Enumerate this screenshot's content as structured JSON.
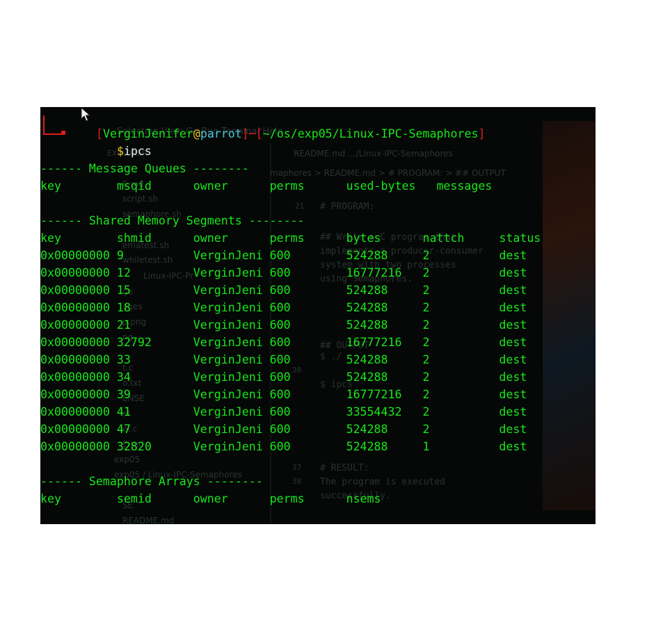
{
  "prompt": {
    "open_bracket": "[",
    "user": "VerginJenifer",
    "at": "@",
    "host": "parrot",
    "separator": "]─[",
    "path": "~/os/exp05/Linux-IPC-Semaphores",
    "close_bracket": "]",
    "symbol": "$",
    "command": "ipcs"
  },
  "message_queues": {
    "header": "------ Message Queues --------",
    "columns": "key        msqid      owner      perms      used-bytes   messages"
  },
  "shared_memory": {
    "header": "------ Shared Memory Segments --------",
    "columns": "key        shmid      owner      perms      bytes      nattch     status",
    "rows": [
      "0x00000000 9          VerginJeni 600        524288     2          dest",
      "0x00000000 12         VerginJeni 600        16777216   2          dest",
      "0x00000000 15         VerginJeni 600        524288     2          dest",
      "0x00000000 18         VerginJeni 600        524288     2          dest",
      "0x00000000 21         VerginJeni 600        524288     2          dest",
      "0x00000000 32792      VerginJeni 600        16777216   2          dest",
      "0x00000000 33         VerginJeni 600        524288     2          dest",
      "0x00000000 34         VerginJeni 600        524288     2          dest",
      "0x00000000 39         VerginJeni 600        16777216   2          dest",
      "0x00000000 41         VerginJeni 600        33554432   2          dest",
      "0x00000000 47         VerginJeni 600        524288     2          dest",
      "0x00000000 32820      VerginJeni 600        524288     1          dest"
    ]
  },
  "semaphore_arrays": {
    "header": "------ Semaphore Arrays --------",
    "columns": "key        semid      owner      perms      nsems"
  },
  "background": {
    "menu": "Selection  View  Go  Run  Terminal  Help",
    "explorer_title": "EXPLORER",
    "tab_title": "README.md  .../Linux-IPC-Semaphores",
    "breadcrumb": "maphores > README.md > # PROGRAM: > ## OUTPUT",
    "files": [
      "E.md",
      "script.sh",
      "semaphore.sh",
      "ematest.sh",
      "whiletest.sh",
      "Linux-IPC-Pr",
      "ge",
      "ages",
      "p.png",
      "ng",
      "t.c",
      "o.txt",
      "ENSE",
      "el",
      "el.c",
      "E.md",
      "exp05",
      "exp05 / Linux-IPC-Semaphores",
      "SE",
      "README.md"
    ],
    "editor_lines": [
      "# PROGRAM:",
      "## Write a C program that",
      "implements a producer-consumer",
      "system with two processes",
      "using Semaphores.",
      "## OUTPUT",
      "$ ./",
      "$ ipcs",
      "# RESULT:",
      "The program is executed",
      "successfully."
    ],
    "line_numbers": [
      "21",
      "30",
      "37",
      "38"
    ]
  },
  "colors": {
    "terminal_bg": "#050807",
    "green": "#19e619",
    "red": "#e01e1e",
    "cyan": "#47c6d8",
    "yellow": "#f0c419"
  }
}
